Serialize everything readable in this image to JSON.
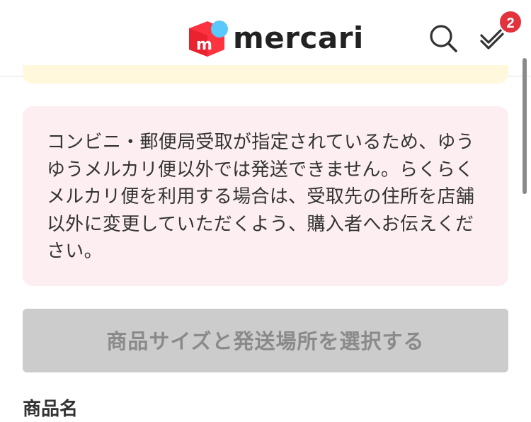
{
  "header": {
    "logo_text": "mercari",
    "icons": [
      "mercari-logo-icon",
      "search-icon",
      "todo-check-icon"
    ],
    "todo_badge_count": "2"
  },
  "notice": {
    "message": "コンビニ・郵便局受取が指定されているため、ゆうゆうメルカリ便以外では発送できません。らくらくメルカリ便を利用する場合は、受取先の住所を店舗以外に変更していただくよう、購入者へお伝えください。"
  },
  "action": {
    "select_size_label": "商品サイズと発送場所を選択する"
  },
  "item": {
    "section_title": "商品名"
  },
  "colors": {
    "brand_red": "#ff333f",
    "badge_red": "#e1333e",
    "alert_background": "#fdeff1",
    "notice_yellow": "#fff8dc",
    "disabled_button": "#cccccc",
    "disabled_text": "#8a8a8a"
  }
}
